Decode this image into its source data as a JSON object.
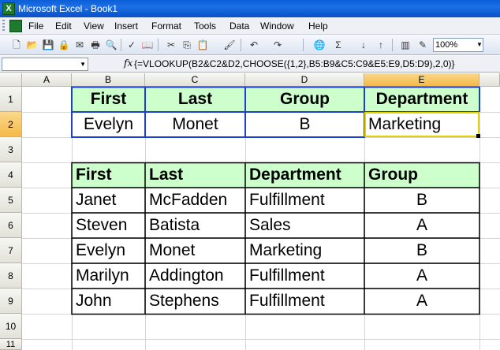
{
  "window": {
    "title": "Microsoft Excel - Book1"
  },
  "menu": [
    "File",
    "Edit",
    "View",
    "Insert",
    "Format",
    "Tools",
    "Data",
    "Window",
    "Help"
  ],
  "toolbar": {
    "zoom": "100%"
  },
  "formula_bar": {
    "name_box": "",
    "fx": "fx",
    "formula": "{=VLOOKUP(B2&C2&D2,CHOOSE({1,2},B5:B9&C5:C9&E5:E9,D5:D9),2,0)}"
  },
  "columns": [
    "A",
    "B",
    "C",
    "D",
    "E"
  ],
  "rows": [
    "1",
    "2",
    "3",
    "4",
    "5",
    "6",
    "7",
    "8",
    "9",
    "10",
    "11"
  ],
  "lookup": {
    "headers": [
      "First",
      "Last",
      "Group",
      "Department"
    ],
    "values": [
      "Evelyn",
      "Monet",
      "B",
      "Marketing"
    ]
  },
  "table": {
    "headers": [
      "First",
      "Last",
      "Department",
      "Group"
    ],
    "rows": [
      [
        "Janet",
        "McFadden",
        "Fulfillment",
        "B"
      ],
      [
        "Steven",
        "Batista",
        "Sales",
        "A"
      ],
      [
        "Evelyn",
        "Monet",
        "Marketing",
        "B"
      ],
      [
        "Marilyn",
        "Addington",
        "Fulfillment",
        "A"
      ],
      [
        "John",
        "Stephens",
        "Fulfillment",
        "A"
      ]
    ]
  },
  "colors": {
    "header_fill": "#ccffcc",
    "lookup_border": "#1f3fd0",
    "active_cell_border": "#e6d000",
    "selected_header": "#f3b94a"
  }
}
